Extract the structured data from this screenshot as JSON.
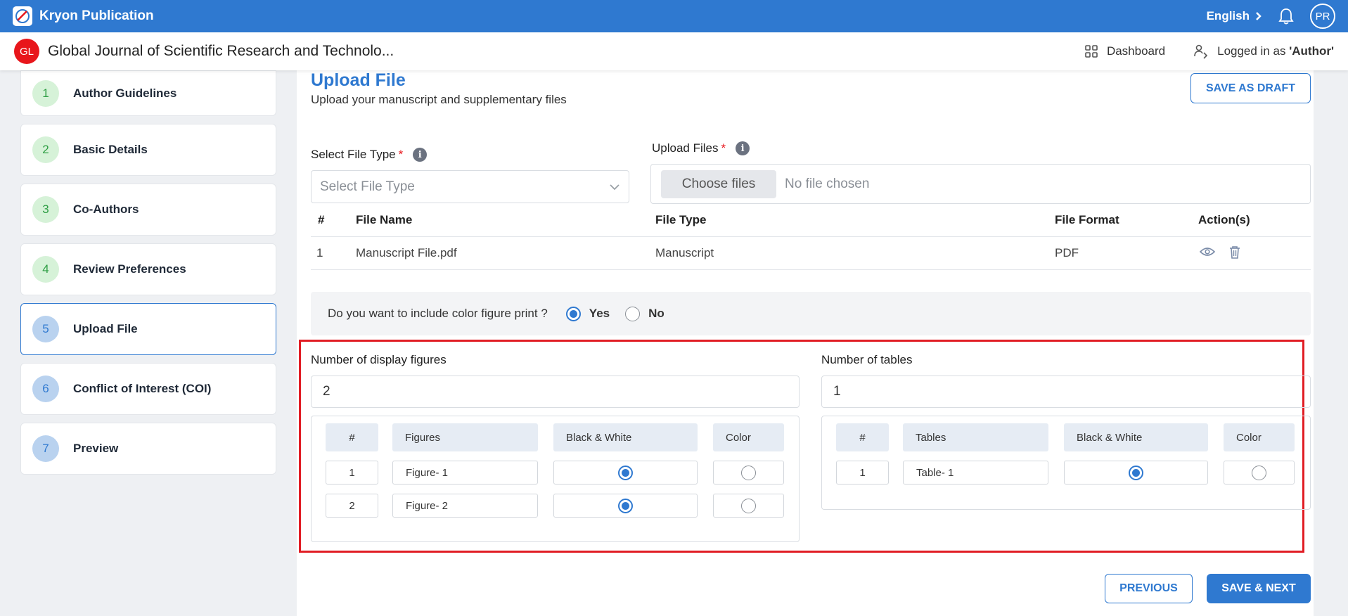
{
  "app": {
    "name": "Kryon Publication",
    "language": "English",
    "user_initials": "PR"
  },
  "journal": {
    "badge": "GL",
    "title": "Global Journal of Scientific Research and Technolo...",
    "dashboard_label": "Dashboard",
    "logged_in_prefix": "Logged in as ",
    "logged_in_role": "'Author'"
  },
  "steps": [
    {
      "num": "1",
      "label": "Author Guidelines",
      "state": "done"
    },
    {
      "num": "2",
      "label": "Basic Details",
      "state": "done"
    },
    {
      "num": "3",
      "label": "Co-Authors",
      "state": "done"
    },
    {
      "num": "4",
      "label": "Review Preferences",
      "state": "done"
    },
    {
      "num": "5",
      "label": "Upload File",
      "state": "active"
    },
    {
      "num": "6",
      "label": "Conflict of Interest (COI)",
      "state": "todo"
    },
    {
      "num": "7",
      "label": "Preview",
      "state": "todo"
    }
  ],
  "main": {
    "title": "Upload File",
    "subtitle": "Upload your manuscript and supplementary files",
    "save_draft": "SAVE AS DRAFT",
    "file_type_label": "Select File Type",
    "file_type_placeholder": "Select File Type",
    "upload_label": "Upload Files",
    "choose_files": "Choose files",
    "no_file": "No file chosen",
    "table": {
      "headers": [
        "#",
        "File Name",
        "File Type",
        "File Format",
        "Action(s)"
      ],
      "rows": [
        {
          "num": "1",
          "name": "Manuscript File.pdf",
          "type": "Manuscript",
          "format": "PDF"
        }
      ]
    },
    "color_question": "Do you want to include color figure print ?",
    "yes": "Yes",
    "no": "No",
    "color_print_selected": "Yes",
    "figures": {
      "label": "Number of display figures",
      "count": "2",
      "headers": [
        "#",
        "Figures",
        "Black & White",
        "Color"
      ],
      "rows": [
        {
          "num": "1",
          "name": "Figure- 1",
          "selected": "Black & White"
        },
        {
          "num": "2",
          "name": "Figure- 2",
          "selected": "Black & White"
        }
      ]
    },
    "tables": {
      "label": "Number of tables",
      "count": "1",
      "headers": [
        "#",
        "Tables",
        "Black & White",
        "Color"
      ],
      "rows": [
        {
          "num": "1",
          "name": "Table- 1",
          "selected": "Black & White"
        }
      ]
    },
    "previous": "PREVIOUS",
    "save_next": "SAVE & NEXT"
  },
  "colors": {
    "primary": "#2f79d0",
    "highlight": "#e11d24",
    "badge": "#e8161b"
  }
}
